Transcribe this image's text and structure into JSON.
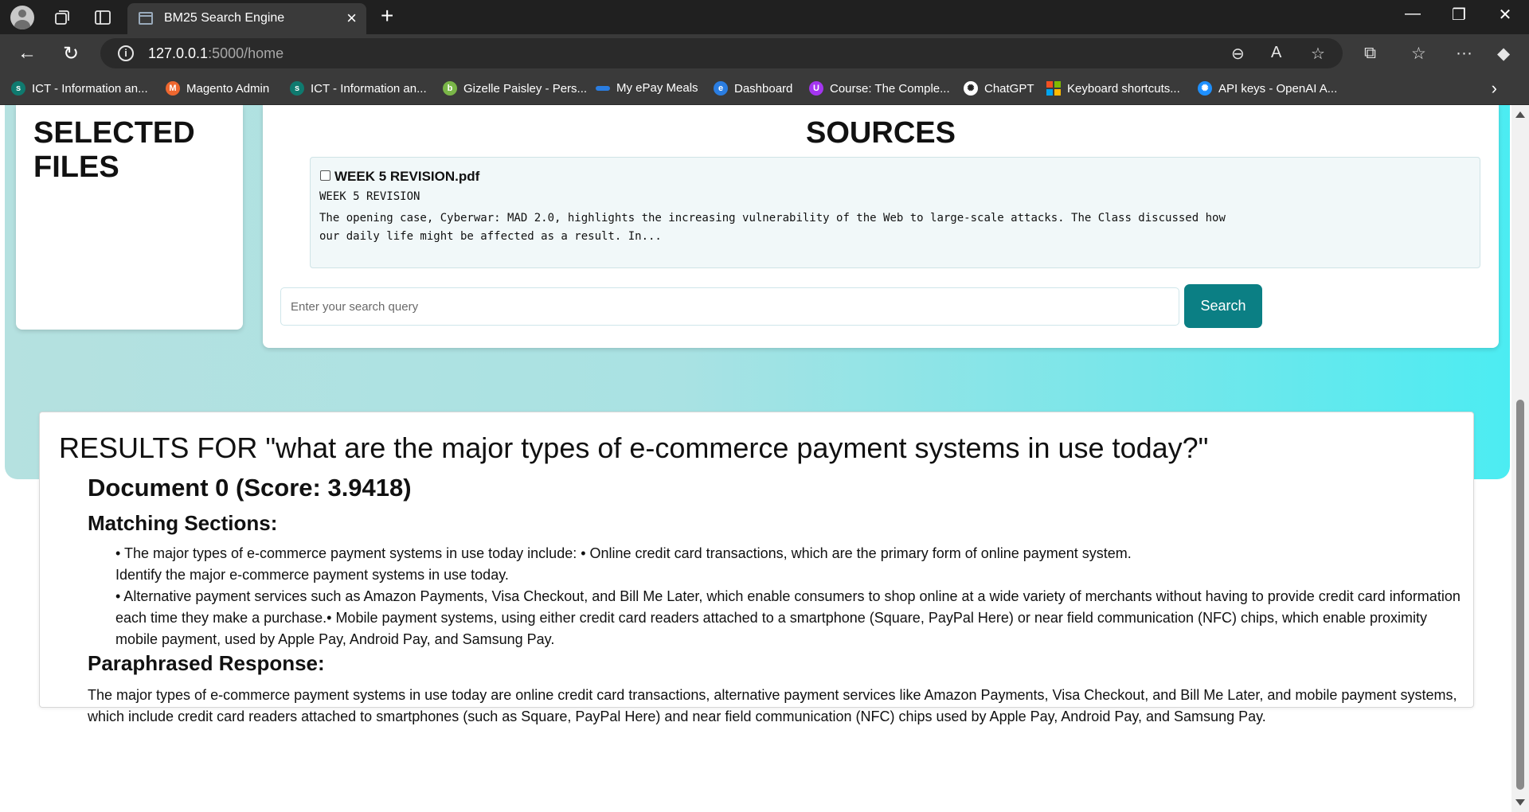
{
  "browser": {
    "tab_title": "BM25 Search Engine",
    "url_host": "127.0.0.1",
    "url_path": ":5000/home",
    "bookmarks": [
      {
        "label": "ICT - Information an...",
        "icon": "sharepoint-icon",
        "color": "#0f7a6f"
      },
      {
        "label": "Magento Admin",
        "icon": "magento-icon",
        "color": "#ee672f"
      },
      {
        "label": "ICT - Information an...",
        "icon": "sharepoint-icon",
        "color": "#0f7a6f"
      },
      {
        "label": "Gizelle Paisley - Pers...",
        "icon": "bitbucket-icon",
        "color": "#7ab648"
      },
      {
        "label": "My ePay Meals",
        "icon": "epay-icon",
        "color": "#2a7de1"
      },
      {
        "label": "Dashboard",
        "icon": "edge-icon",
        "color": "#2a7de1"
      },
      {
        "label": "Course: The Comple...",
        "icon": "udemy-icon",
        "color": "#a435f0"
      },
      {
        "label": "ChatGPT",
        "icon": "chatgpt-icon",
        "color": "#ffffff"
      },
      {
        "label": "Keyboard shortcuts...",
        "icon": "microsoft-icon",
        "color": "#f25022"
      },
      {
        "label": "API keys - OpenAI A...",
        "icon": "openai-icon",
        "color": "#1e90ff"
      }
    ]
  },
  "sidebar": {
    "title": "SELECTED FILES"
  },
  "sources": {
    "title": "SOURCES",
    "items": [
      {
        "filename": "WEEK 5 REVISION.pdf",
        "heading": "WEEK 5 REVISION",
        "snippet": "The opening case, Cyberwar: MAD 2.0, highlights the increasing vulnerability of the Web to large-scale attacks. The Class discussed how our daily life might be affected as a result. In..."
      }
    ]
  },
  "search": {
    "placeholder": "Enter your search query",
    "button_label": "Search"
  },
  "results": {
    "title": "RESULTS FOR \"what are the major types of e-commerce payment systems in use today?\"",
    "document_title": "Document 0 (Score: 3.9418)",
    "matching_heading": "Matching Sections:",
    "matching_lines": [
      "• The major types of e-commerce payment systems in use today include: • Online credit card transactions, which are the primary form of online payment system.",
      "Identify the major e-commerce payment systems in use today.",
      "• Alternative payment services such as Amazon Payments, Visa Checkout, and Bill Me Later, which enable consumers to shop online at a wide variety of merchants without having to provide credit card information each time they make a purchase.• Mobile payment systems, using either credit card readers attached to a smartphone (Square, PayPal Here) or near field communication (NFC) chips, which enable proximity mobile payment, used by Apple Pay, Android Pay, and Samsung Pay."
    ],
    "paraphrased_heading": "Paraphrased Response:",
    "paraphrased_text": "The major types of e-commerce payment systems in use today are online credit card transactions, alternative payment services like Amazon Payments, Visa Checkout, and Bill Me Later, and mobile payment systems, which include credit card readers attached to smartphones (such as Square, PayPal Here) and near field communication (NFC) chips used by Apple Pay, Android Pay, and Samsung Pay."
  },
  "colors": {
    "accent": "#0b7f84",
    "hero_gradient_start": "#b5e1e0",
    "hero_gradient_end": "#4cecf2"
  }
}
